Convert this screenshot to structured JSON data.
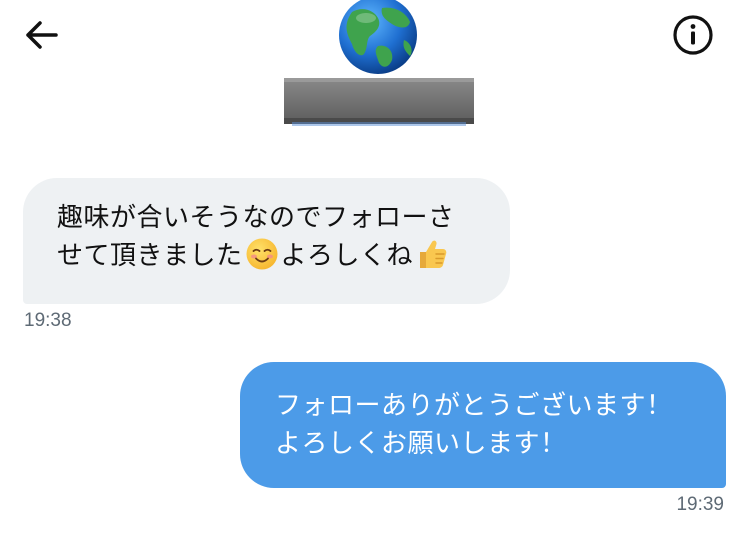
{
  "header": {
    "back_icon": "arrow-left-icon",
    "info_icon": "info-circle-icon",
    "image": "globe-on-pedestal"
  },
  "messages": [
    {
      "direction": "incoming",
      "line1": "趣味が合いそうなのでフォローさ",
      "line2_a": "せて頂きました",
      "emoji1": "smiling-face-icon",
      "line2_b": "よろしくね",
      "emoji2": "thumbs-up-icon",
      "time": "19:38",
      "bubble_color": "#eef1f3"
    },
    {
      "direction": "outgoing",
      "line1": "フォローありがとうございます！",
      "line2": "よろしくお願いします！",
      "time": "19:39",
      "bubble_color": "#4c9be8"
    }
  ]
}
